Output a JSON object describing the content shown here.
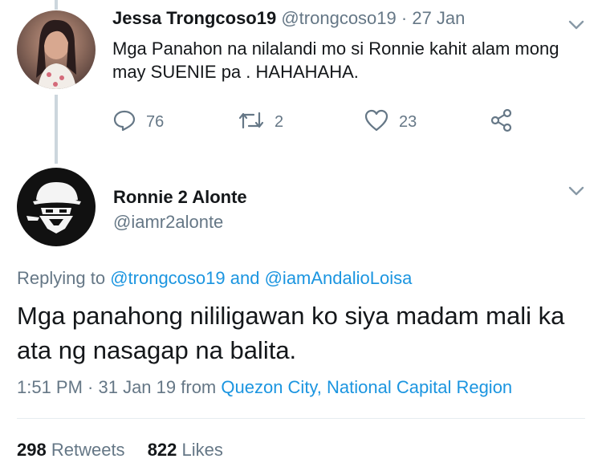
{
  "parent_tweet": {
    "author_name": "Jessa Trongcoso19",
    "author_handle": "@trongcoso19",
    "date": "· 27 Jan",
    "text": "Mga Panahon na nilalandi mo si Ronnie kahit alam mong may SUENIE pa . HAHAHAHA.",
    "avatar_icon": "profile-photo-woman",
    "actions": {
      "reply_count": "76",
      "retweet_count": "2",
      "like_count": "23"
    }
  },
  "main_tweet": {
    "author_name": "Ronnie 2 Alonte",
    "author_handle": "@iamr2alonte",
    "avatar_icon": "masked-face-avatar",
    "replying_prefix": "Replying to",
    "replying_user1": "@trongcoso19",
    "replying_and": "and",
    "replying_user2": "@iamAndalioLoisa",
    "text": "Mga panahong nililigawan ko siya madam mali ka ata ng nasagap na balita.",
    "time": "1:51 PM · 31 Jan 19",
    "from_label": "from",
    "location": "Quezon City, National Capital Region"
  },
  "stats": {
    "retweets_count": "298",
    "retweets_label": "Retweets",
    "likes_count": "822",
    "likes_label": "Likes"
  },
  "colors": {
    "link": "#1b95e0",
    "secondary_text": "#657786",
    "primary_text": "#14171a",
    "thread_line": "#ccd6dd"
  }
}
